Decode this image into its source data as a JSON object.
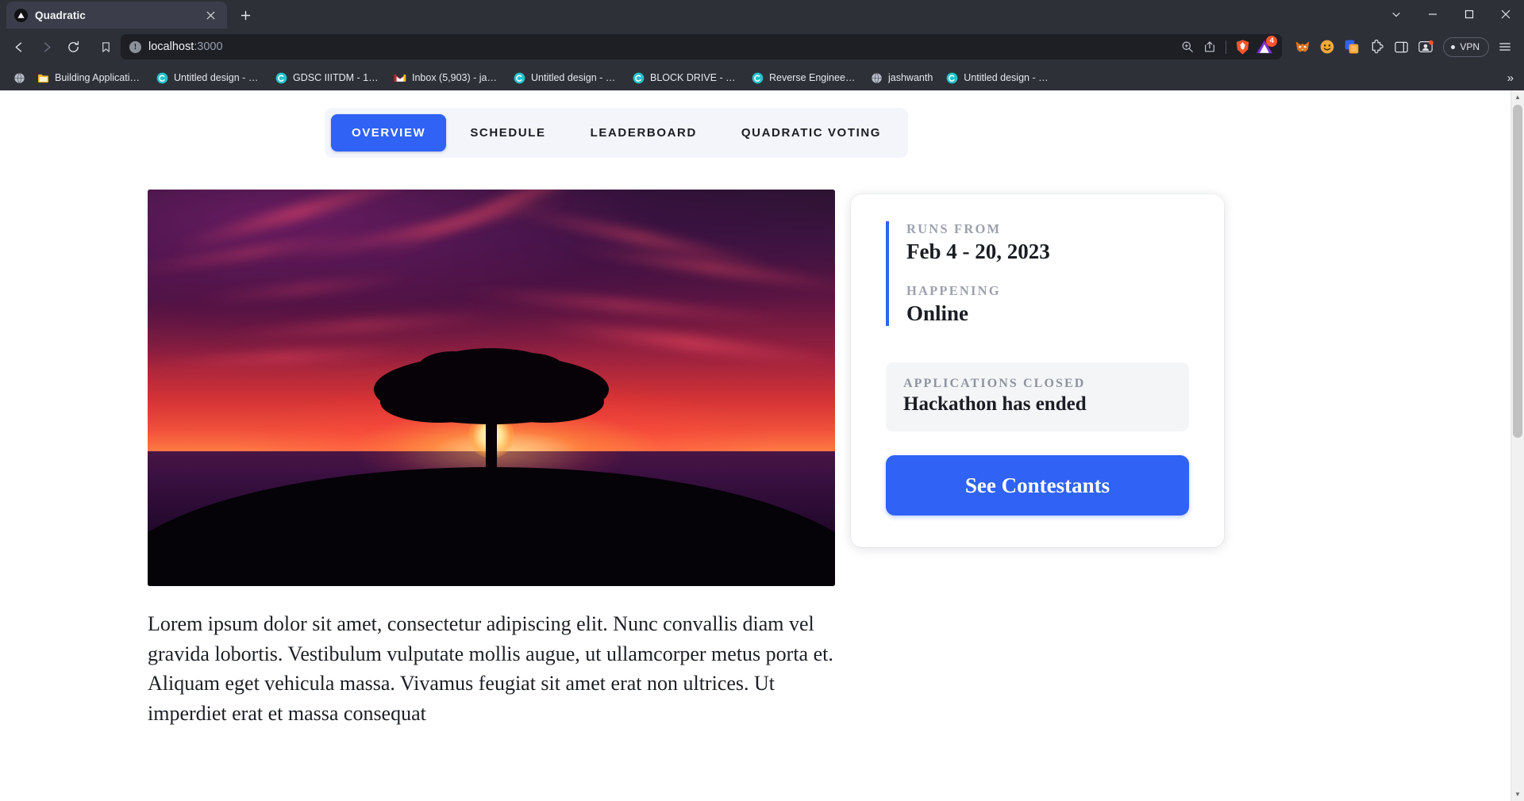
{
  "browser": {
    "tab": {
      "title": "Quadratic",
      "favicon": "quadratic-logo-icon",
      "close": "×"
    },
    "newtab_label": "+",
    "window_controls": {
      "minimize": "—",
      "maximize": "□",
      "close": "✕",
      "tab_search": "⌄"
    },
    "nav": {
      "back": "back-arrow",
      "forward": "forward-arrow",
      "reload": "reload-arrow",
      "bookmark": "bookmark-outline"
    },
    "omnibox": {
      "info_glyph": "!",
      "url_host": "localhost",
      "url_port": ":3000",
      "zoom_icon": "zoom-in-icon",
      "share_icon": "share-icon",
      "shields_icon": "brave-shields-lion-icon",
      "extension_badge_count": "4"
    },
    "toolbar": {
      "extensions_label": "extensions-puzzle-icon",
      "sidebar_label": "sidebar-panel-icon",
      "profile_label": "profile-icon",
      "vpn_label": "VPN",
      "menu_label": "browser-menu-icon"
    },
    "bookmarks": [
      {
        "label": "Building Applicatio...",
        "icon": "globe-icon"
      },
      {
        "label": "Building Applicatio...",
        "icon": "folder-icon"
      },
      {
        "label": "Untitled design - 10...",
        "icon": "canva-icon"
      },
      {
        "label": "GDSC IIITDM - 100...",
        "icon": "canva-icon"
      },
      {
        "label": "Inbox (5,903) - jash...",
        "icon": "gmail-icon"
      },
      {
        "label": "Untitled design - 10...",
        "icon": "canva-icon"
      },
      {
        "label": "BLOCK DRIVE - Pres...",
        "icon": "canva-icon"
      },
      {
        "label": "Reverse Engineerin...",
        "icon": "canva-icon"
      },
      {
        "label": "jashwanth",
        "icon": "globe-icon"
      },
      {
        "label": "Untitled design - 10...",
        "icon": "canva-icon"
      }
    ],
    "bookmarks_overflow": "»"
  },
  "page": {
    "tabs": [
      {
        "label": "OVERVIEW",
        "active": true
      },
      {
        "label": "SCHEDULE",
        "active": false
      },
      {
        "label": "LEADERBOARD",
        "active": false
      },
      {
        "label": "QUADRATIC VOTING",
        "active": false
      }
    ],
    "hero": {
      "alt": "hackathon-banner-image"
    },
    "description": "Lorem ipsum dolor sit amet, consectetur adipiscing elit. Nunc convallis diam vel gravida lobortis. Vestibulum vulputate mollis augue, ut ullamcorper metus porta et. Aliquam eget vehicula massa. Vivamus feugiat sit amet erat non ultrices. Ut imperdiet erat et massa consequat",
    "info_card": {
      "runs_from_label": "RUNS FROM",
      "runs_from_value": "Feb 4 - 20, 2023",
      "happening_label": "HAPPENING",
      "happening_value": "Online",
      "status_label": "APPLICATIONS CLOSED",
      "status_value": "Hackathon has ended",
      "cta_label": "See Contestants"
    }
  },
  "colors": {
    "accent_blue": "#2f62f5",
    "chrome_bg": "#2e3038",
    "omnibox_bg": "#1d1f25",
    "badge_orange": "#fb542b"
  }
}
